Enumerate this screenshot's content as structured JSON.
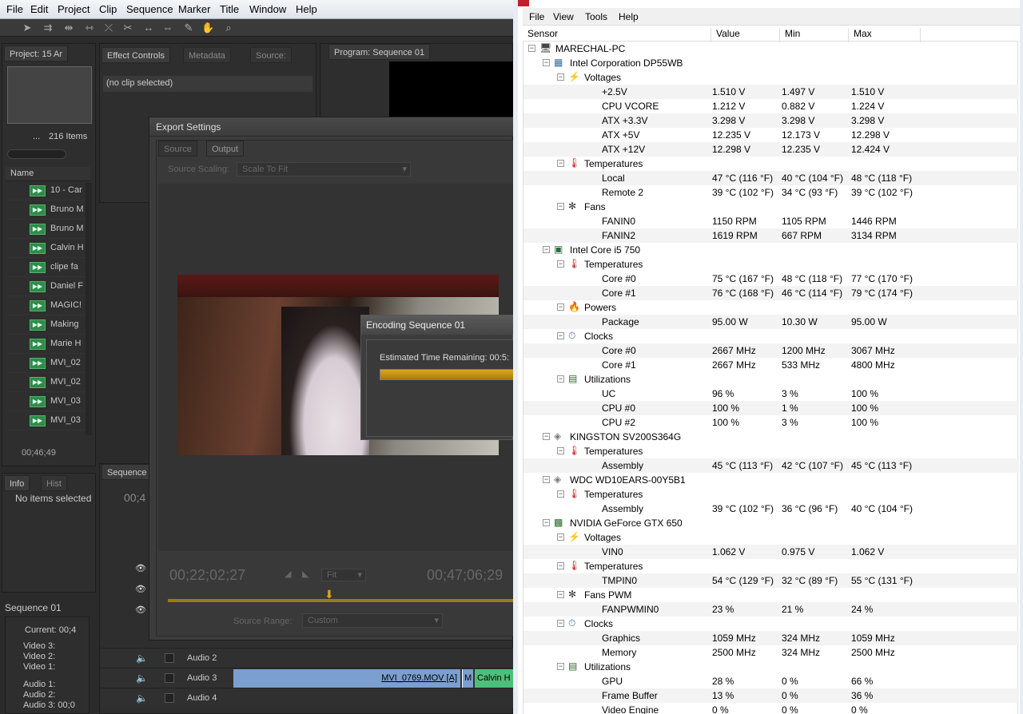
{
  "premiere": {
    "menu": [
      "File",
      "Edit",
      "Project",
      "Clip",
      "Sequence",
      "Marker",
      "Title",
      "Window",
      "Help"
    ],
    "project_tab": "Project: 15 Ar",
    "effect_tabs": [
      "Effect Controls",
      "Metadata",
      "Source:"
    ],
    "program_tab": "Program: Sequence 01",
    "no_clip": "(no clip selected)",
    "items_count": "216 Items",
    "name_col": "Name",
    "items": [
      "10 - Car",
      "Bruno M",
      "Bruno M",
      "Calvin H",
      "clipe fa",
      "Daniel F",
      "MAGIC!",
      "Making",
      "Marie H",
      "MVI_02",
      "MVI_02",
      "MVI_03",
      "MVI_03"
    ],
    "timecode_small": "00;46;49",
    "info_tabs": [
      "Info",
      "Hist"
    ],
    "no_items": "No items selected",
    "sequence_tab": "Sequence",
    "seq_time_small": "00;4",
    "sequence_label": "Sequence 01",
    "current": "Current:  00;4",
    "tracks_info": [
      "Video 3:",
      "Video 2:",
      "Video 1:",
      "Audio 1:",
      "Audio 2:",
      "Audio 3: 00;0"
    ],
    "audio_tracks": [
      "Audio 2",
      "Audio 3",
      "Audio 4"
    ],
    "clip_label": "MVI_0769.MOV [A]",
    "clip_small": "M",
    "clip_green": "Calvin H"
  },
  "export": {
    "title": "Export Settings",
    "tabs": [
      "Source",
      "Output"
    ],
    "scaling_label": "Source Scaling:",
    "scaling_value": "Scale To Fit",
    "tc_in": "00;22;02;27",
    "tc_out": "00;47;06;29",
    "fit": "Fit",
    "range_label": "Source Range:",
    "range_value": "Custom"
  },
  "encoding": {
    "title": "Encoding Sequence 01",
    "estimate": "Estimated Time Remaining: 00:5:"
  },
  "hwmonitor": {
    "menu": [
      "File",
      "View",
      "Tools",
      "Help"
    ],
    "columns": [
      "Sensor",
      "Value",
      "Min",
      "Max"
    ],
    "rows": [
      {
        "level": 0,
        "icon": "computer-icon",
        "label": "MARECHAL-PC"
      },
      {
        "level": 1,
        "icon": "motherboard-icon",
        "label": "Intel Corporation DP55WB"
      },
      {
        "level": 2,
        "icon": "voltage-icon",
        "label": "Voltages"
      },
      {
        "level": 3,
        "label": "+2.5V",
        "value": "1.510 V",
        "min": "1.497 V",
        "max": "1.510 V"
      },
      {
        "level": 3,
        "label": "CPU VCORE",
        "value": "1.212 V",
        "min": "0.882 V",
        "max": "1.224 V"
      },
      {
        "level": 3,
        "label": "ATX +3.3V",
        "value": "3.298 V",
        "min": "3.298 V",
        "max": "3.298 V"
      },
      {
        "level": 3,
        "label": "ATX +5V",
        "value": "12.235 V",
        "min": "12.173 V",
        "max": "12.298 V"
      },
      {
        "level": 3,
        "label": "ATX +12V",
        "value": "12.298 V",
        "min": "12.235 V",
        "max": "12.424 V"
      },
      {
        "level": 2,
        "icon": "thermometer-icon",
        "label": "Temperatures"
      },
      {
        "level": 3,
        "label": "Local",
        "value": "47 °C  (116 °F)",
        "min": "40 °C  (104 °F)",
        "max": "48 °C  (118 °F)"
      },
      {
        "level": 3,
        "label": "Remote 2",
        "value": "39 °C  (102 °F)",
        "min": "34 °C  (93 °F)",
        "max": "39 °C  (102 °F)"
      },
      {
        "level": 2,
        "icon": "fan-icon",
        "label": "Fans"
      },
      {
        "level": 3,
        "label": "FANIN0",
        "value": "1150 RPM",
        "min": "1105 RPM",
        "max": "1446 RPM"
      },
      {
        "level": 3,
        "label": "FANIN2",
        "value": "1619 RPM",
        "min": "667 RPM",
        "max": "3134 RPM"
      },
      {
        "level": 1,
        "icon": "cpu-icon",
        "label": "Intel Core i5 750"
      },
      {
        "level": 2,
        "icon": "thermometer-icon",
        "label": "Temperatures"
      },
      {
        "level": 3,
        "label": "Core #0",
        "value": "75 °C  (167 °F)",
        "min": "48 °C  (118 °F)",
        "max": "77 °C  (170 °F)"
      },
      {
        "level": 3,
        "label": "Core #1",
        "value": "76 °C  (168 °F)",
        "min": "46 °C  (114 °F)",
        "max": "79 °C  (174 °F)"
      },
      {
        "level": 2,
        "icon": "power-icon",
        "label": "Powers"
      },
      {
        "level": 3,
        "label": "Package",
        "value": "95.00 W",
        "min": "10.30 W",
        "max": "95.00 W"
      },
      {
        "level": 2,
        "icon": "clock-icon",
        "label": "Clocks"
      },
      {
        "level": 3,
        "label": "Core #0",
        "value": "2667 MHz",
        "min": "1200 MHz",
        "max": "3067 MHz"
      },
      {
        "level": 3,
        "label": "Core #1",
        "value": "2667 MHz",
        "min": "533 MHz",
        "max": "4800 MHz"
      },
      {
        "level": 2,
        "icon": "utilization-icon",
        "label": "Utilizations"
      },
      {
        "level": 3,
        "label": "UC",
        "value": "96 %",
        "min": "3 %",
        "max": "100 %"
      },
      {
        "level": 3,
        "label": "CPU #0",
        "value": "100 %",
        "min": "1 %",
        "max": "100 %"
      },
      {
        "level": 3,
        "label": "CPU #2",
        "value": "100 %",
        "min": "3 %",
        "max": "100 %"
      },
      {
        "level": 1,
        "icon": "disk-icon",
        "label": "KINGSTON SV200S364G"
      },
      {
        "level": 2,
        "icon": "thermometer-icon",
        "label": "Temperatures"
      },
      {
        "level": 3,
        "label": "Assembly",
        "value": "45 °C  (113 °F)",
        "min": "42 °C  (107 °F)",
        "max": "45 °C  (113 °F)"
      },
      {
        "level": 1,
        "icon": "disk-icon",
        "label": "WDC WD10EARS-00Y5B1"
      },
      {
        "level": 2,
        "icon": "thermometer-icon",
        "label": "Temperatures"
      },
      {
        "level": 3,
        "label": "Assembly",
        "value": "39 °C  (102 °F)",
        "min": "36 °C  (96 °F)",
        "max": "40 °C  (104 °F)"
      },
      {
        "level": 1,
        "icon": "gpu-icon",
        "label": "NVIDIA GeForce GTX 650"
      },
      {
        "level": 2,
        "icon": "voltage-icon",
        "label": "Voltages"
      },
      {
        "level": 3,
        "label": "VIN0",
        "value": "1.062 V",
        "min": "0.975 V",
        "max": "1.062 V"
      },
      {
        "level": 2,
        "icon": "thermometer-icon",
        "label": "Temperatures"
      },
      {
        "level": 3,
        "label": "TMPIN0",
        "value": "54 °C  (129 °F)",
        "min": "32 °C  (89 °F)",
        "max": "55 °C  (131 °F)"
      },
      {
        "level": 2,
        "icon": "fan-icon",
        "label": "Fans PWM"
      },
      {
        "level": 3,
        "label": "FANPWMIN0",
        "value": "23 %",
        "min": "21 %",
        "max": "24 %"
      },
      {
        "level": 2,
        "icon": "clock-icon",
        "label": "Clocks"
      },
      {
        "level": 3,
        "label": "Graphics",
        "value": "1059 MHz",
        "min": "324 MHz",
        "max": "1059 MHz"
      },
      {
        "level": 3,
        "label": "Memory",
        "value": "2500 MHz",
        "min": "324 MHz",
        "max": "2500 MHz"
      },
      {
        "level": 2,
        "icon": "utilization-icon",
        "label": "Utilizations"
      },
      {
        "level": 3,
        "label": "GPU",
        "value": "28 %",
        "min": "0 %",
        "max": "66 %"
      },
      {
        "level": 3,
        "label": "Frame Buffer",
        "value": "13 %",
        "min": "0 %",
        "max": "36 %"
      },
      {
        "level": 3,
        "label": "Video Engine",
        "value": "0 %",
        "min": "0 %",
        "max": "0 %"
      }
    ]
  }
}
